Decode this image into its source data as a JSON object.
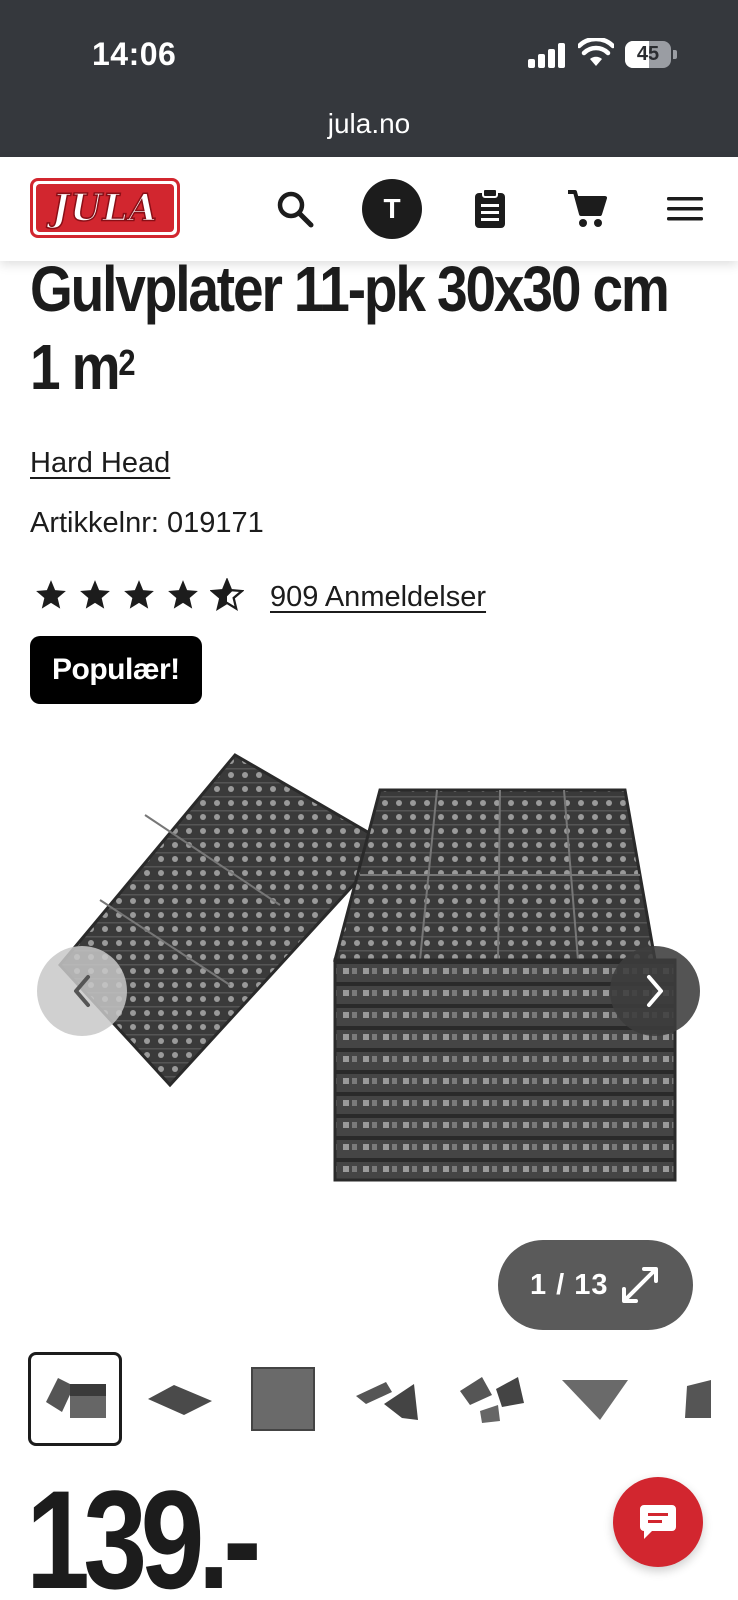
{
  "status_bar": {
    "time": "14:06",
    "battery": "45"
  },
  "browser": {
    "url": "jula.no"
  },
  "header": {
    "logo_text": "JULA",
    "avatar_initial": "T",
    "icons": [
      "search-icon",
      "clipboard-icon",
      "cart-icon",
      "menu-icon"
    ]
  },
  "product": {
    "title_line1": "Gulvplater 11-pk 30x30 cm",
    "title_line2": "1 m",
    "title_sup": "2",
    "brand": "Hard Head",
    "article_number": "Artikkelnr: 019171",
    "rating": 4.5,
    "reviews": "909 Anmeldelser",
    "badge": "Populær!",
    "price": "139.-"
  },
  "gallery": {
    "counter": "1 / 13",
    "thumbnail_count": 7,
    "active_index": 0
  },
  "colors": {
    "brand_red": "#d2262f",
    "dark": "#1c1c1c",
    "topbar": "#35383d"
  }
}
